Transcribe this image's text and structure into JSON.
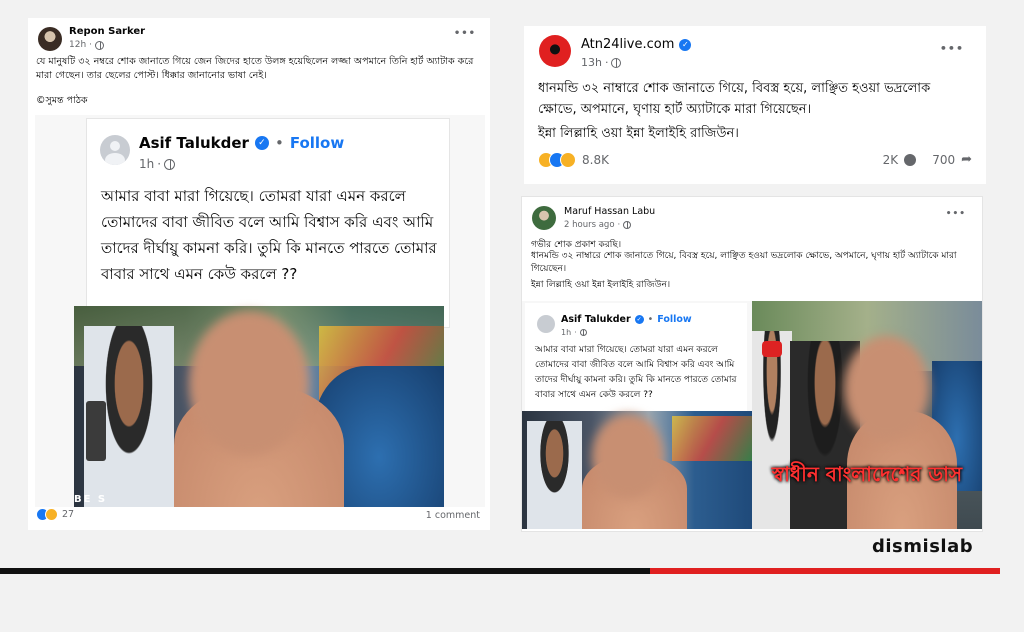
{
  "left_post": {
    "author": "Repon Sarker",
    "time": "12h",
    "more": "•••",
    "body": "যে মানুষটি ৩২ নম্বরে শোক জানাতে গিয়ে জেন জিদের হাতে উলঙ্গ হয়েছিলেন লজ্জা অপমানে তিনি হার্ট অ্যাটাক করে মারা গেছেন। তার ছেলের পোস্ট। ধিক্কার জানানোর ভাষা নেই।",
    "credit": "©সুমন্ত পাঠক",
    "shared_post": {
      "author": "Asif Talukder",
      "dot": "•",
      "follow": "Follow",
      "time": "1h",
      "body": "আমার বাবা মারা গিয়েছে। তোমরা যারা এমন করলে তোমাদের বাবা জীবিত বলে আমি বিশ্বাস করি এবং আমি তাদের দীর্ঘায়ু কামনা করি। তুমি কি মানতে পারতে তোমার বাবার সাথে এমন কেউ করলে ??"
    },
    "reaction_count": "27",
    "comments": "1 comment"
  },
  "top_right_post": {
    "author": "Atn24live.com",
    "time": "13h",
    "more": "•••",
    "line1": "ধানমন্ডি ৩২ নাম্বারে শোক জানাতে গিয়ে, বিবস্ত্র হয়ে, লাঞ্ছিত হওয়া ভদ্রলোক ক্ষোভে, অপমানে, ঘৃণায় হার্ট অ্যাটাকে মারা গিয়েছেন।",
    "line2": "ইন্না লিল্লাহি ওয়া ইন্না ইলাইহি রাজিউন।",
    "reaction_count": "8.8K",
    "comments": "2K",
    "shares": "700"
  },
  "bottom_right_post": {
    "author": "Maruf Hassan Labu",
    "time": "2 hours ago",
    "more": "•••",
    "line1": "গভীর শোক প্রকাশ করছি।",
    "line2": "ধানমন্ডি ৩২ নাম্বারে শোক জানাতে গিয়ে, বিবস্ত্র হয়ে, লাঞ্ছিত হওয়া ভদ্রলোক ক্ষোভে, অপমানে, ঘৃণায় হার্ট অ্যাটাকে মারা গিয়েছেন।",
    "line3": "ইন্না লিল্লাহি ওয়া ইন্না ইলাইহি রাজিউন।",
    "shared_post": {
      "author": "Asif Talukder",
      "dot": "•",
      "follow": "Follow",
      "time": "1h",
      "body": "আমার বাবা মারা গিয়েছে। তোমরা যারা এমন করলে তোমাদের বাবা জীবিত বলে আমি বিশ্বাস করি এবং আমি তাদের দীর্ঘায়ু কামনা করি। তুমি কি মানতে পারতে তোমার বাবার সাথে এমন কেউ করলে ??"
    },
    "photo_caption": "স্বাধীন বাংলাদেশের ডাস"
  },
  "brand": "dismislab",
  "colors": {
    "facebook_blue": "#1877f2",
    "brand_red": "#e02020",
    "text_secondary": "#65676b"
  },
  "icons": [
    "globe-icon",
    "verified-icon",
    "more-icon",
    "like-icon",
    "sad-icon",
    "haha-icon",
    "comment-icon",
    "share-icon"
  ]
}
